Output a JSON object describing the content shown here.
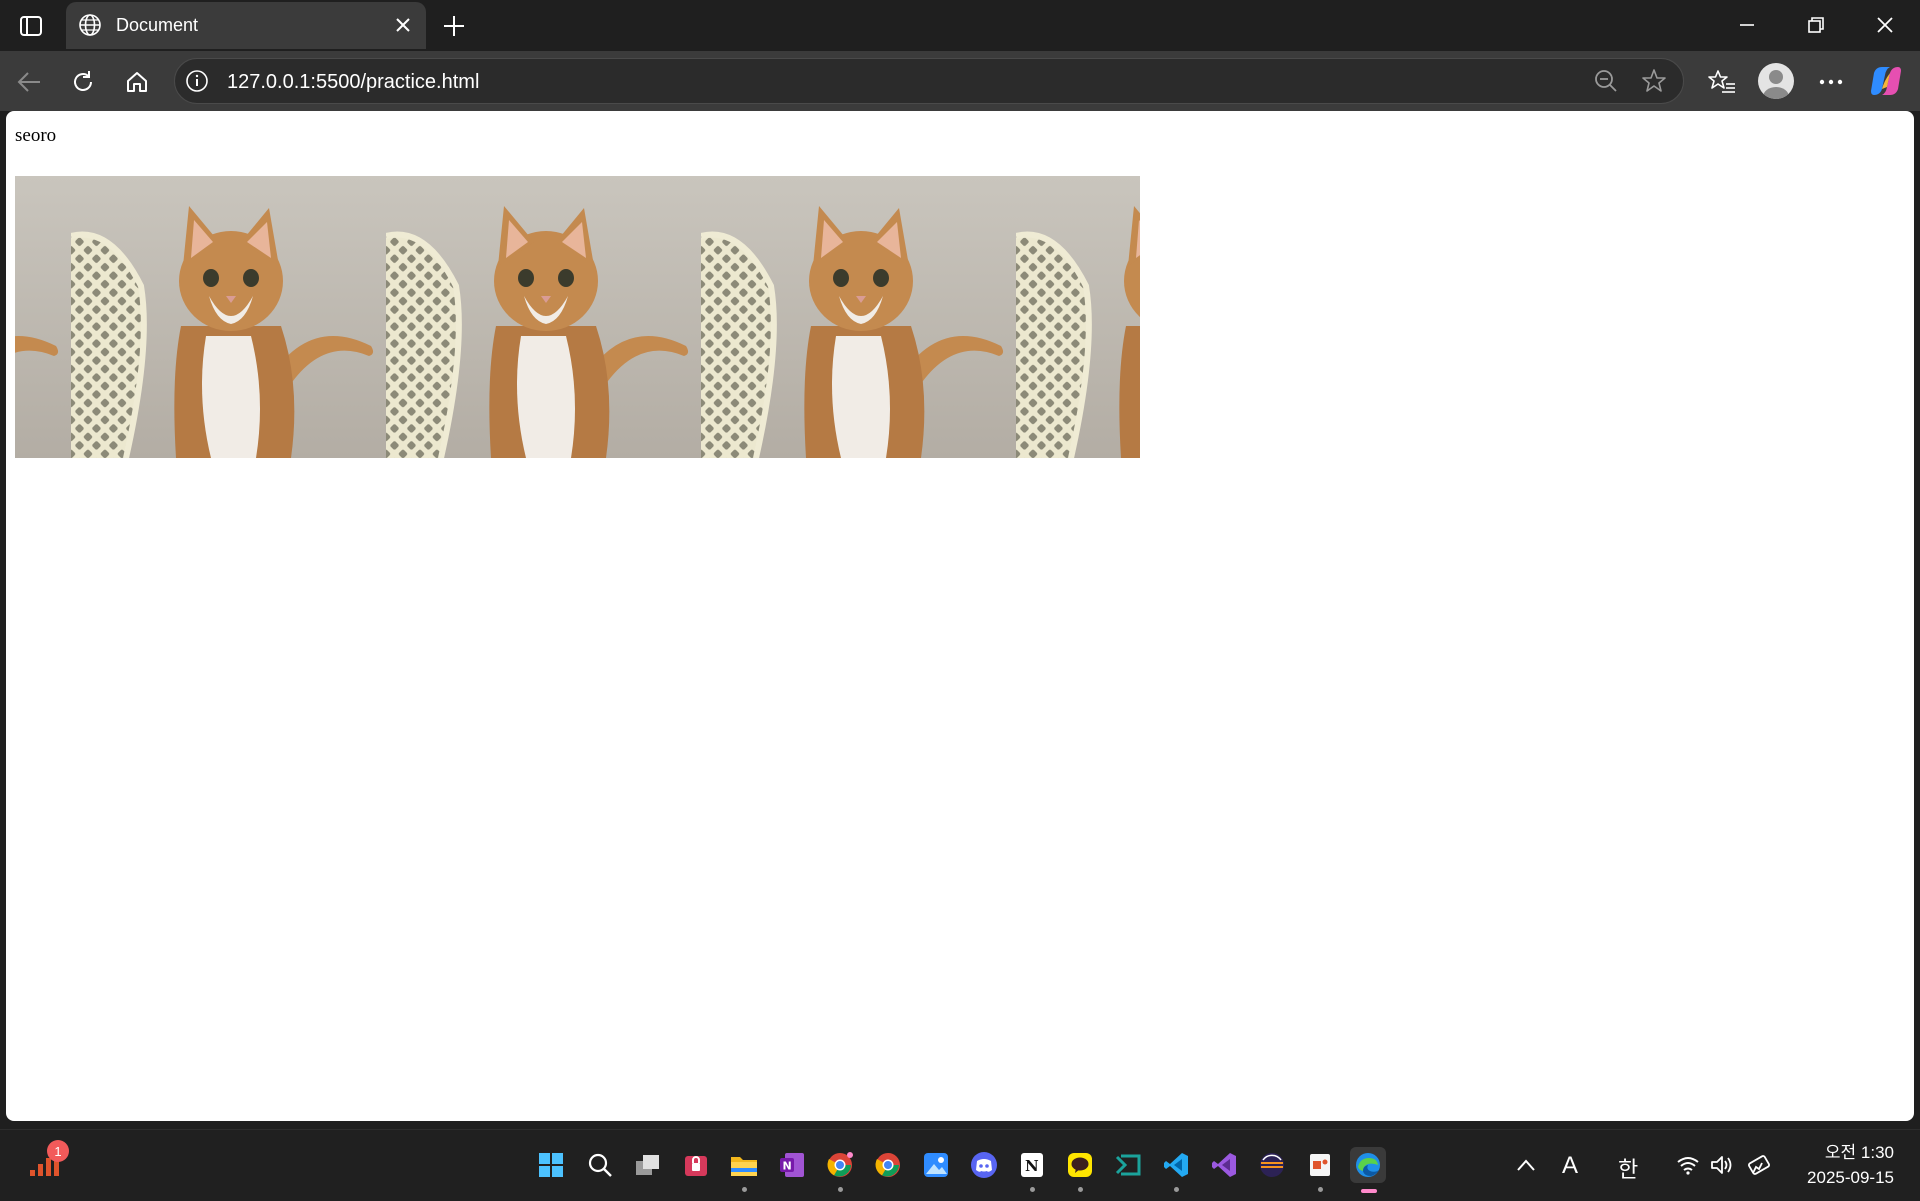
{
  "tab": {
    "title": "Document"
  },
  "address_bar": {
    "url": "127.0.0.1:5500/practice.html"
  },
  "page": {
    "text": "seoro",
    "marquee_images": [
      "cat-photo",
      "cat-photo",
      "cat-photo",
      "cat-photo",
      "cat-photo"
    ]
  },
  "taskbar": {
    "notification_count": "1",
    "ime_letter": "A",
    "ime_lang": "한",
    "time": "오전 1:30",
    "date": "2025-09-15",
    "pinned_apps": [
      "windows-start",
      "search",
      "task-view",
      "password-app",
      "file-explorer",
      "onenote",
      "chrome-profile",
      "chrome",
      "photos",
      "discord",
      "notion",
      "kakaotalk",
      "vs-code-insiders",
      "vs-code",
      "visual-studio",
      "eclipse",
      "office-app",
      "edge"
    ]
  },
  "colors": {
    "chrome_dark": "#1f1f1f",
    "toolbar": "#3b3b3b",
    "taskbar": "#202020",
    "accent_edge_active": "#ff8acb"
  }
}
